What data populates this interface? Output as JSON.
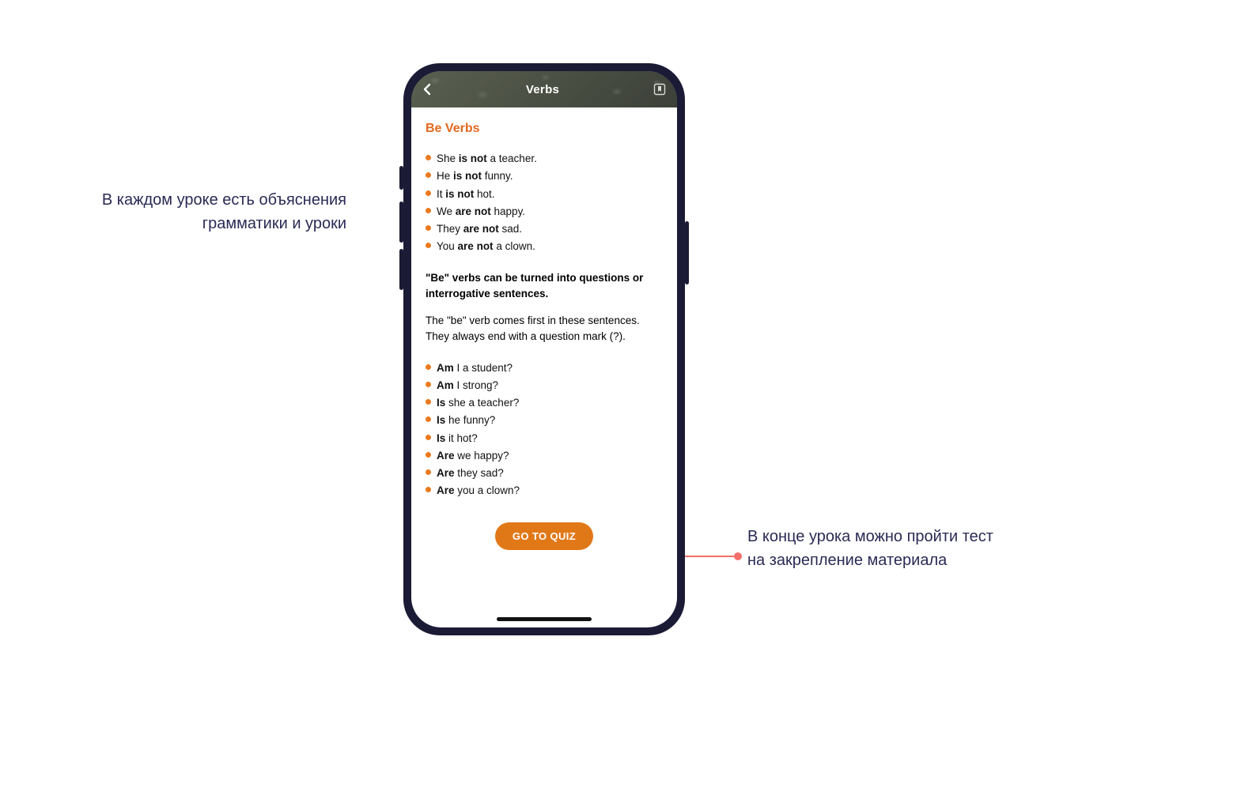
{
  "header": {
    "title": "Verbs"
  },
  "lesson": {
    "section_title": "Be Verbs",
    "neg_examples": [
      {
        "pre": "She ",
        "b": "is not",
        "post": " a teacher."
      },
      {
        "pre": "He ",
        "b": "is not",
        "post": " funny."
      },
      {
        "pre": "It ",
        "b": "is not",
        "post": " hot."
      },
      {
        "pre": "We ",
        "b": "are not",
        "post": " happy."
      },
      {
        "pre": "They ",
        "b": "are not",
        "post": " sad."
      },
      {
        "pre": "You ",
        "b": "are not",
        "post": " a clown."
      }
    ],
    "para_bold": "\"Be\" verbs can be turned into questions or interrogative sentences.",
    "para": "The \"be\" verb comes first in these sentences. They always end with a question mark (?).",
    "q_examples": [
      {
        "b": "Am",
        "post": " I a student?"
      },
      {
        "b": "Am",
        "post": " I strong?"
      },
      {
        "b": "Is",
        "post": " she a teacher?"
      },
      {
        "b": "Is",
        "post": " he funny?"
      },
      {
        "b": "Is",
        "post": " it hot?"
      },
      {
        "b": "Are",
        "post": " we happy?"
      },
      {
        "b": "Are",
        "post": " they sad?"
      },
      {
        "b": "Are",
        "post": " you a clown?"
      }
    ],
    "quiz_button": "GO TO QUIZ"
  },
  "annotations": {
    "left": "В каждом уроке есть объяснения грамматики и уроки",
    "right": "В конце урока можно пройти тест на закрепление материала"
  }
}
